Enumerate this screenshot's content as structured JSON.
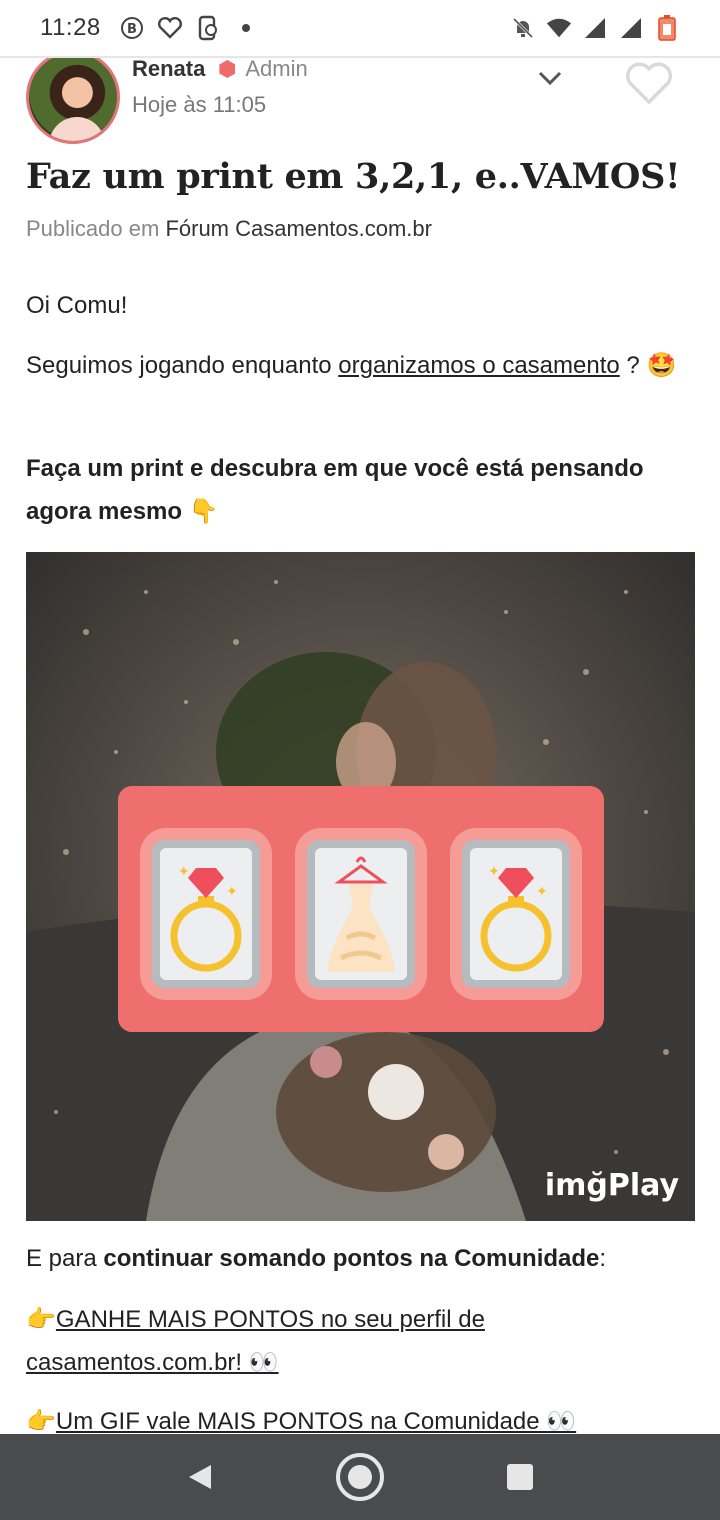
{
  "status_bar": {
    "time": "11:28",
    "left_icons": [
      "b-circle-icon",
      "heart-outline-icon",
      "phone-sync-icon",
      "dot-icon"
    ],
    "right_icons": [
      "notifications-off-icon",
      "wifi-icon",
      "signal-icon",
      "signal-icon",
      "battery-low-icon"
    ]
  },
  "post": {
    "author_name": "Renata",
    "role": "Admin",
    "time": "Hoje às 11:05",
    "title": "Faz um print em 3,2,1, e..VAMOS!",
    "published_prefix": "Publicado em",
    "forum": "Fórum Casamentos.com.br",
    "greeting": "Oi Comu!",
    "para1_prefix": "Seguimos jogando enquanto",
    "para1_link": "organizamos o casamento",
    "para1_suffix": "?",
    "para1_emoji": "🤩",
    "para2": "Faça um print e descubra em que você está pensando agora mesmo",
    "para2_emoji": "👇",
    "image_watermark": "imğPlay",
    "slots": [
      "ring-icon",
      "wedding-dress-icon",
      "ring-icon"
    ],
    "para3_prefix": "E para",
    "para3_bold": "continuar somando pontos na Comunidade",
    "para3_suffix": ":",
    "bullet_emoji": "👉",
    "link1": "GANHE MAIS PONTOS no seu perfil de casamentos.com.br! 👀",
    "link2": "Um GIF vale MAIS PONTOS na Comunidade 👀"
  },
  "colors": {
    "accent": "#ef6b6b",
    "slot_panel": "#ef6f6e",
    "navbar": "#4a4b4d"
  },
  "nav": {
    "icons": [
      "back-icon",
      "home-icon",
      "recents-icon"
    ]
  }
}
